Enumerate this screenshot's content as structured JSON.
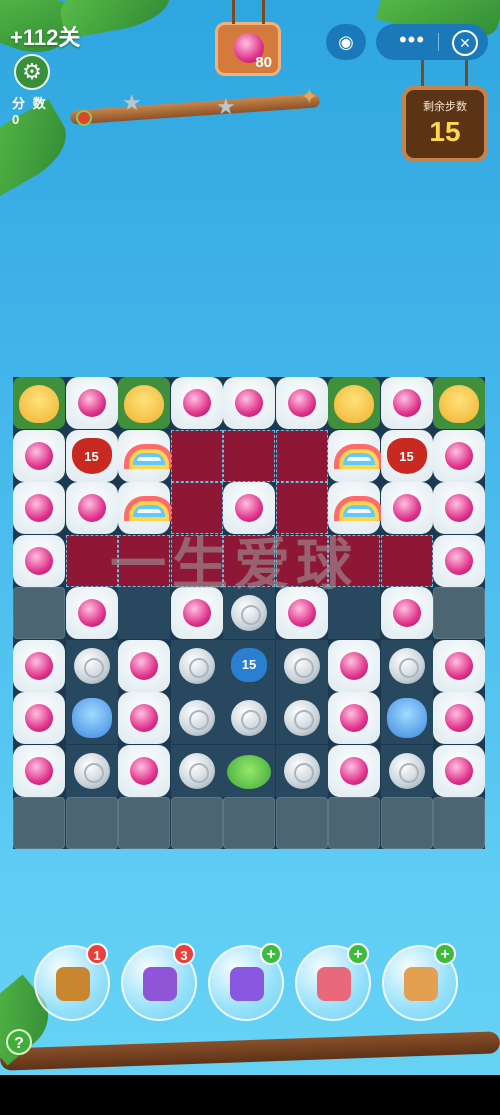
{
  "hud": {
    "level": "+112关",
    "settings_icon": "gear-icon",
    "score_label": "分 数",
    "score_value": "0",
    "target_count": "80",
    "moves_label": "剩余步数",
    "moves_value": "15",
    "menu_more": "•••",
    "menu_close": "✕"
  },
  "board": {
    "cols": 9,
    "rows": 9,
    "cells": [
      [
        "grass:chick",
        "cloud:orb",
        "grass:chick",
        "cloud:orb",
        "cloud:orb",
        "cloud:orb",
        "grass:chick",
        "cloud:orb",
        "grass:chick"
      ],
      [
        "cloud:orb",
        "cloud:cat",
        "cloud:rainbow",
        "jelly:",
        "jelly:",
        "jelly:",
        "cloud:rainbow",
        "cloud:cat",
        "cloud:orb"
      ],
      [
        "cloud:orb",
        "cloud:orb",
        "cloud:rainbow",
        "jelly:",
        "cloud:orb",
        "jelly:",
        "cloud:rainbow",
        "cloud:orb",
        "cloud:orb"
      ],
      [
        "cloud:orb",
        "jelly:",
        "jelly:",
        "jelly:",
        "jelly:",
        "jelly:",
        "jelly:",
        "jelly:",
        "cloud:orb"
      ],
      [
        "stone:",
        "cloud:orb",
        "empty:",
        "cloud:orb",
        "empty:coin",
        "cloud:orb",
        "empty:",
        "cloud:orb",
        "stone:"
      ],
      [
        "cloud:orb",
        "empty:coin",
        "cloud:orb",
        "empty:coin",
        "empty:blueblob",
        "empty:coin",
        "cloud:orb",
        "empty:coin",
        "cloud:orb"
      ],
      [
        "cloud:orb",
        "empty:blob",
        "cloud:orb",
        "empty:coin",
        "empty:coin",
        "empty:coin",
        "cloud:orb",
        "empty:blob",
        "cloud:orb"
      ],
      [
        "cloud:orb",
        "empty:coin",
        "cloud:orb",
        "empty:coin",
        "empty:frog",
        "empty:coin",
        "cloud:orb",
        "empty:coin",
        "cloud:orb"
      ],
      [
        "stone:",
        "stone:",
        "stone:",
        "stone:",
        "stone:",
        "stone:",
        "stone:",
        "stone:",
        "stone:"
      ]
    ],
    "cat_label": "15",
    "blueblob_label": "15"
  },
  "watermark": "一生爱球",
  "boosters": [
    {
      "icon": "shuffle-board-icon",
      "badge": "1",
      "badge_type": "red"
    },
    {
      "icon": "swap-creatures-icon",
      "badge": "3",
      "badge_type": "red"
    },
    {
      "icon": "rocket-fish-icon",
      "badge": "+",
      "badge_type": "green"
    },
    {
      "icon": "rocket-icon",
      "badge": "+",
      "badge_type": "green"
    },
    {
      "icon": "hammer-icon",
      "badge": "+",
      "badge_type": "green"
    }
  ],
  "help": "?",
  "colors": {
    "sky": "#46b8ec",
    "jelly": "#8e1735",
    "moves_text": "#ffd84d"
  }
}
